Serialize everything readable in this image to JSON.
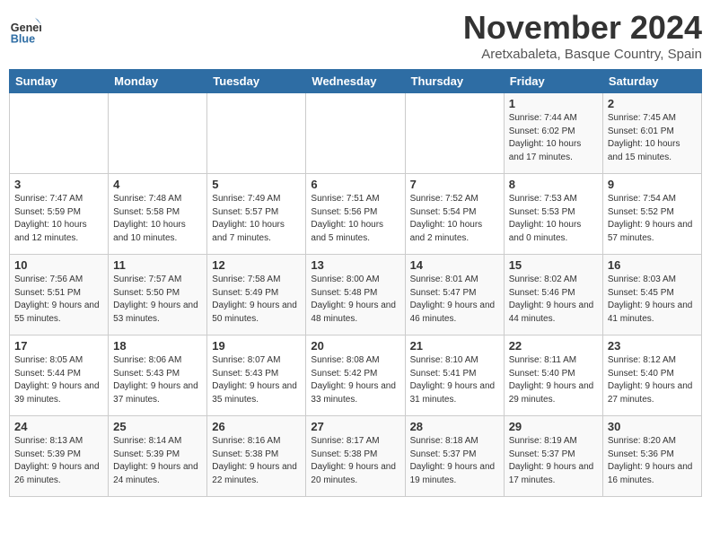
{
  "header": {
    "logo_text_general": "General",
    "logo_text_blue": "Blue",
    "title": "November 2024",
    "subtitle": "Aretxabaleta, Basque Country, Spain"
  },
  "weekdays": [
    "Sunday",
    "Monday",
    "Tuesday",
    "Wednesday",
    "Thursday",
    "Friday",
    "Saturday"
  ],
  "weeks": [
    [
      {
        "day": "",
        "info": ""
      },
      {
        "day": "",
        "info": ""
      },
      {
        "day": "",
        "info": ""
      },
      {
        "day": "",
        "info": ""
      },
      {
        "day": "",
        "info": ""
      },
      {
        "day": "1",
        "info": "Sunrise: 7:44 AM\nSunset: 6:02 PM\nDaylight: 10 hours and 17 minutes."
      },
      {
        "day": "2",
        "info": "Sunrise: 7:45 AM\nSunset: 6:01 PM\nDaylight: 10 hours and 15 minutes."
      }
    ],
    [
      {
        "day": "3",
        "info": "Sunrise: 7:47 AM\nSunset: 5:59 PM\nDaylight: 10 hours and 12 minutes."
      },
      {
        "day": "4",
        "info": "Sunrise: 7:48 AM\nSunset: 5:58 PM\nDaylight: 10 hours and 10 minutes."
      },
      {
        "day": "5",
        "info": "Sunrise: 7:49 AM\nSunset: 5:57 PM\nDaylight: 10 hours and 7 minutes."
      },
      {
        "day": "6",
        "info": "Sunrise: 7:51 AM\nSunset: 5:56 PM\nDaylight: 10 hours and 5 minutes."
      },
      {
        "day": "7",
        "info": "Sunrise: 7:52 AM\nSunset: 5:54 PM\nDaylight: 10 hours and 2 minutes."
      },
      {
        "day": "8",
        "info": "Sunrise: 7:53 AM\nSunset: 5:53 PM\nDaylight: 10 hours and 0 minutes."
      },
      {
        "day": "9",
        "info": "Sunrise: 7:54 AM\nSunset: 5:52 PM\nDaylight: 9 hours and 57 minutes."
      }
    ],
    [
      {
        "day": "10",
        "info": "Sunrise: 7:56 AM\nSunset: 5:51 PM\nDaylight: 9 hours and 55 minutes."
      },
      {
        "day": "11",
        "info": "Sunrise: 7:57 AM\nSunset: 5:50 PM\nDaylight: 9 hours and 53 minutes."
      },
      {
        "day": "12",
        "info": "Sunrise: 7:58 AM\nSunset: 5:49 PM\nDaylight: 9 hours and 50 minutes."
      },
      {
        "day": "13",
        "info": "Sunrise: 8:00 AM\nSunset: 5:48 PM\nDaylight: 9 hours and 48 minutes."
      },
      {
        "day": "14",
        "info": "Sunrise: 8:01 AM\nSunset: 5:47 PM\nDaylight: 9 hours and 46 minutes."
      },
      {
        "day": "15",
        "info": "Sunrise: 8:02 AM\nSunset: 5:46 PM\nDaylight: 9 hours and 44 minutes."
      },
      {
        "day": "16",
        "info": "Sunrise: 8:03 AM\nSunset: 5:45 PM\nDaylight: 9 hours and 41 minutes."
      }
    ],
    [
      {
        "day": "17",
        "info": "Sunrise: 8:05 AM\nSunset: 5:44 PM\nDaylight: 9 hours and 39 minutes."
      },
      {
        "day": "18",
        "info": "Sunrise: 8:06 AM\nSunset: 5:43 PM\nDaylight: 9 hours and 37 minutes."
      },
      {
        "day": "19",
        "info": "Sunrise: 8:07 AM\nSunset: 5:43 PM\nDaylight: 9 hours and 35 minutes."
      },
      {
        "day": "20",
        "info": "Sunrise: 8:08 AM\nSunset: 5:42 PM\nDaylight: 9 hours and 33 minutes."
      },
      {
        "day": "21",
        "info": "Sunrise: 8:10 AM\nSunset: 5:41 PM\nDaylight: 9 hours and 31 minutes."
      },
      {
        "day": "22",
        "info": "Sunrise: 8:11 AM\nSunset: 5:40 PM\nDaylight: 9 hours and 29 minutes."
      },
      {
        "day": "23",
        "info": "Sunrise: 8:12 AM\nSunset: 5:40 PM\nDaylight: 9 hours and 27 minutes."
      }
    ],
    [
      {
        "day": "24",
        "info": "Sunrise: 8:13 AM\nSunset: 5:39 PM\nDaylight: 9 hours and 26 minutes."
      },
      {
        "day": "25",
        "info": "Sunrise: 8:14 AM\nSunset: 5:39 PM\nDaylight: 9 hours and 24 minutes."
      },
      {
        "day": "26",
        "info": "Sunrise: 8:16 AM\nSunset: 5:38 PM\nDaylight: 9 hours and 22 minutes."
      },
      {
        "day": "27",
        "info": "Sunrise: 8:17 AM\nSunset: 5:38 PM\nDaylight: 9 hours and 20 minutes."
      },
      {
        "day": "28",
        "info": "Sunrise: 8:18 AM\nSunset: 5:37 PM\nDaylight: 9 hours and 19 minutes."
      },
      {
        "day": "29",
        "info": "Sunrise: 8:19 AM\nSunset: 5:37 PM\nDaylight: 9 hours and 17 minutes."
      },
      {
        "day": "30",
        "info": "Sunrise: 8:20 AM\nSunset: 5:36 PM\nDaylight: 9 hours and 16 minutes."
      }
    ]
  ]
}
